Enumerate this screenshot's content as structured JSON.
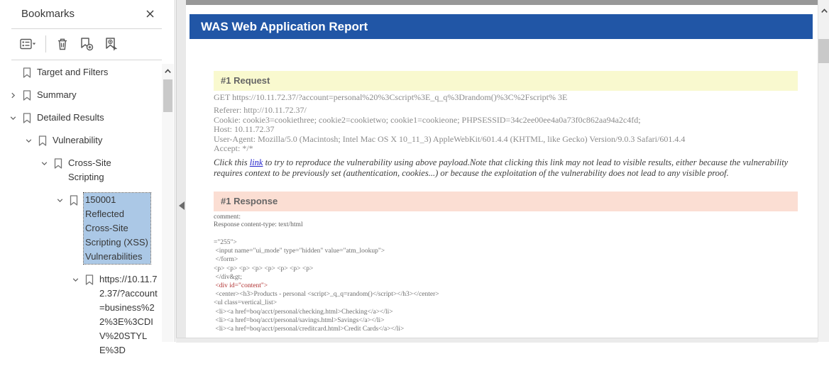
{
  "sidebar": {
    "title": "Bookmarks",
    "toolbar_icons": [
      "bookmark-options-icon",
      "delete-bookmark-icon",
      "new-bookmark-icon",
      "locate-bookmark-icon"
    ],
    "tree": [
      {
        "label": "Target and Filters",
        "level": 0,
        "chevron": "none",
        "selected": false
      },
      {
        "label": "Summary",
        "level": 0,
        "chevron": "collapsed",
        "selected": false
      },
      {
        "label": "Detailed Results",
        "level": 0,
        "chevron": "expanded",
        "selected": false
      },
      {
        "label": "Vulnerability",
        "level": 1,
        "chevron": "expanded",
        "selected": false
      },
      {
        "label": "Cross-Site Scripting",
        "level": 2,
        "chevron": "expanded",
        "selected": false
      },
      {
        "label": "150001 Reflected Cross-Site Scripting (XSS) Vulnerabilities",
        "level": 3,
        "chevron": "expanded",
        "selected": true
      },
      {
        "label": "https://10.11.72.37/?account=business%22%3E%3CDIV%20STYLE%3D",
        "level": 4,
        "chevron": "expanded",
        "selected": false
      }
    ]
  },
  "report": {
    "title": "WAS Web Application Report",
    "title_bg": "#2156a6",
    "request": {
      "header": "#1 Request",
      "header_bg": "#f9f9cf",
      "request_line": "GET https://10.11.72.37/?account=personal%20%3Cscript%3E_q_q%3Drandom()%3C%2Fscript% 3E",
      "headers": [
        "Referer: http://10.11.72.37/",
        "Cookie: cookie3=cookiethree; cookie2=cookietwo; cookie1=cookieone; PHPSESSID=34c2ee00ee4a0a73f0c862aa94a2c4fd;",
        "Host: 10.11.72.37",
        "User-Agent: Mozilla/5.0 (Macintosh; Intel Mac OS X 10_11_3) AppleWebKit/601.4.4 (KHTML, like Gecko) Version/9.0.3 Safari/601.4.4",
        "Accept: */*"
      ],
      "note_prefix": "Click this ",
      "note_link": "link",
      "note_suffix": " to try to reproduce the vulnerability using above payload.Note that clicking this link may not lead to visible results, either because the vulnerability requires context to be previously set (authentication, cookies...) or because the exploitation of the vulnerability does not lead to any visible proof."
    },
    "response": {
      "header": "#1 Response",
      "header_bg": "#fbded3",
      "meta": [
        "comment:",
        "Response content-type: text/html"
      ],
      "code_lines": [
        {
          "t": "=\"255\">"
        },
        {
          "t": " <input name=\"ui_mode\" type=\"hidden\" value=\"atm_lookup\">"
        },
        {
          "t": " </form>"
        },
        {
          "t": "<p> <p> <p> <p> <p> <p> <p> <p>"
        },
        {
          "t": " </div&gt;"
        },
        {
          "t": " <div id=\"content\">",
          "red": true
        },
        {
          "t": " <center><h3>Products - personal <script>_q_q=random()</script></h3></center>"
        },
        {
          "t": "<ul class=vertical_list>"
        },
        {
          "t": " <li><a href=boq/acct/personal/checking.html>Checking</a></li>"
        },
        {
          "t": " <li><a href=boq/acct/personal/savings.html>Savings</a></li>"
        },
        {
          "t": " <li><a href=boq/acct/personal/creditcard.html>Credit Cards</a></li>"
        }
      ]
    }
  }
}
